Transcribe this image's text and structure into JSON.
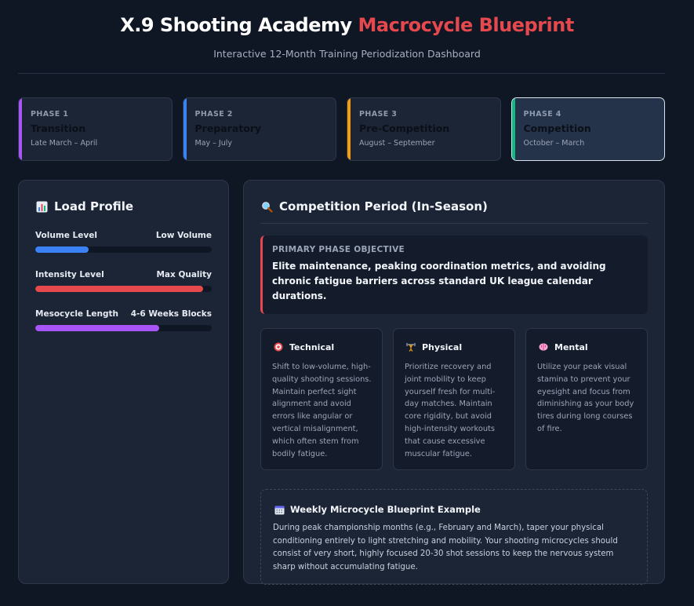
{
  "header": {
    "title_main": "X.9 Shooting Academy",
    "title_accent": "Macrocycle Blueprint",
    "subtitle": "Interactive 12-Month Training Periodization Dashboard"
  },
  "phases": [
    {
      "num": "PHASE 1",
      "name": "Transition",
      "dates": "Late March – April",
      "color": "#a855f7"
    },
    {
      "num": "PHASE 2",
      "name": "Preparatory",
      "dates": "May – July",
      "color": "#3b82f6"
    },
    {
      "num": "PHASE 3",
      "name": "Pre-Competition",
      "dates": "August – September",
      "color": "#f59e0b"
    },
    {
      "num": "PHASE 4",
      "name": "Competition",
      "dates": "October – March",
      "color": "#10b981",
      "active": true
    }
  ],
  "load_profile": {
    "title": "Load Profile",
    "icon": "bar-chart-icon",
    "metrics": [
      {
        "label": "Volume Level",
        "value": "Low Volume",
        "fill": 0.3,
        "color": "#3b82f6"
      },
      {
        "label": "Intensity Level",
        "value": "Max Quality",
        "fill": 0.95,
        "color": "#e5484d"
      },
      {
        "label": "Mesocycle Length",
        "value": "4-6 Weeks Blocks",
        "fill": 0.7,
        "color": "#a855f7"
      }
    ]
  },
  "detail": {
    "title": "Competition Period (In-Season)",
    "icon": "magnifier-icon",
    "objective_label": "PRIMARY PHASE OBJECTIVE",
    "objective_text": "Elite maintenance, peaking coordination metrics, and avoiding chronic fatigue barriers across standard UK league calendar durations.",
    "pillars": [
      {
        "title": "Technical",
        "icon": "target-icon",
        "glyph": "🎯",
        "text": "Shift to low-volume, high-quality shooting sessions. Maintain perfect sight alignment and avoid errors like angular or vertical misalignment, which often stem from bodily fatigue."
      },
      {
        "title": "Physical",
        "icon": "weightlifter-icon",
        "glyph": "🏋",
        "text": "Prioritize recovery and joint mobility to keep yourself fresh for multi-day matches. Maintain core rigidity, but avoid high-intensity workouts that cause excessive muscular fatigue."
      },
      {
        "title": "Mental",
        "icon": "brain-icon",
        "glyph": "🧠",
        "text": "Utilize your peak visual stamina to prevent your eyesight and focus from diminishing as your body tires during long courses of fire."
      }
    ],
    "micro_title": "Weekly Microcycle Blueprint Example",
    "micro_icon": "calendar-icon",
    "micro_text": "During peak championship months (e.g., February and March), taper your physical conditioning entirely to light stretching and mobility. Your shooting microcycles should consist of very short, highly focused 20-30 shot sessions to keep the nervous system sharp without accumulating fatigue."
  }
}
